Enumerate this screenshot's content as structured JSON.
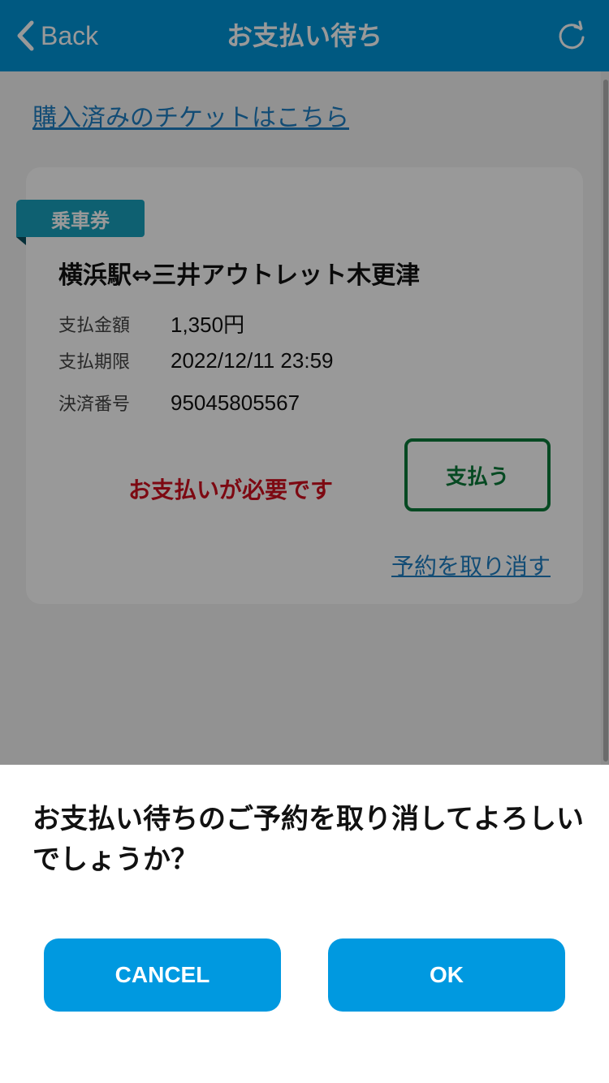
{
  "header": {
    "back_label": "Back",
    "title": "お支払い待ち"
  },
  "purchased_link": "購入済みのチケットはこちら",
  "card": {
    "ticket_type": "乗車券",
    "route": "横浜駅⇔三井アウトレット木更津",
    "rows": [
      {
        "label": "支払金額",
        "value": "1,350円"
      },
      {
        "label": "支払期限",
        "value": "2022/12/11 23:59"
      },
      {
        "label": "決済番号",
        "value": "95045805567"
      }
    ],
    "payment_required": "お支払いが必要です",
    "pay_button": "支払う",
    "cancel_reservation": "予約を取り消す"
  },
  "dialog": {
    "message": "お支払い待ちのご予約を取り消してよろしいでしょうか？",
    "cancel_button": "CANCEL",
    "ok_button": "OK"
  },
  "colors": {
    "header": "#0094d8",
    "link": "#1f7fc4",
    "ribbon": "#18a1bd",
    "alert": "#d10f1e",
    "pay": "#0a7a39",
    "dialog_button": "#0099e0"
  }
}
